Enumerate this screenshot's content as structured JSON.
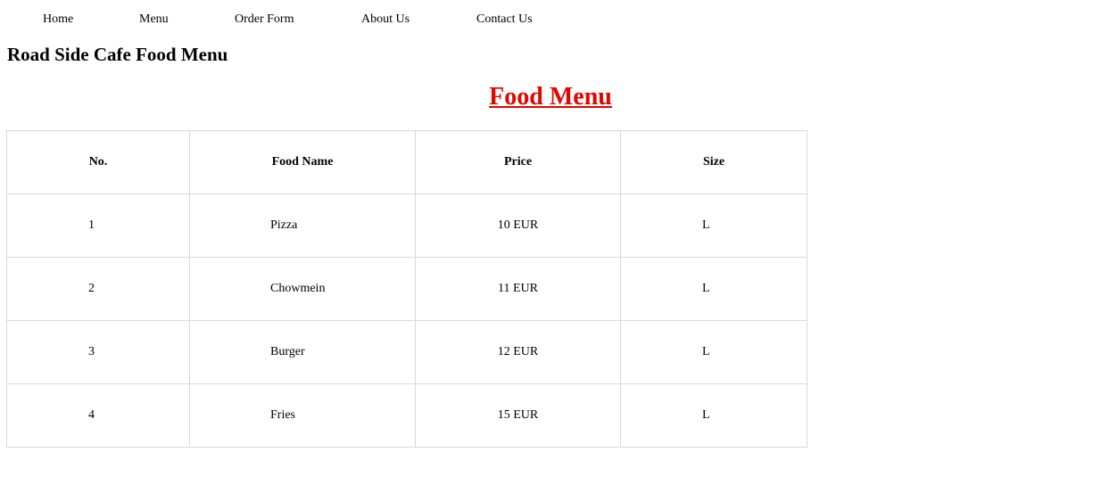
{
  "nav": {
    "items": [
      {
        "label": "Home"
      },
      {
        "label": "Menu"
      },
      {
        "label": "Order Form"
      },
      {
        "label": "About Us"
      },
      {
        "label": "Contact Us"
      }
    ]
  },
  "site_title": "Road Side Cafe Food Menu",
  "menu_heading": "Food Menu",
  "colors": {
    "heading": "#e10600",
    "table_border": "#d9d9d9"
  },
  "table": {
    "headers": [
      "No.",
      "Food Name",
      "Price",
      "Size"
    ],
    "rows": [
      {
        "no": "1",
        "name": "Pizza",
        "price": "10 EUR",
        "size": "L"
      },
      {
        "no": "2",
        "name": "Chowmein",
        "price": "11 EUR",
        "size": "L"
      },
      {
        "no": "3",
        "name": "Burger",
        "price": "12 EUR",
        "size": "L"
      },
      {
        "no": "4",
        "name": "Fries",
        "price": "15 EUR",
        "size": "L"
      }
    ]
  }
}
